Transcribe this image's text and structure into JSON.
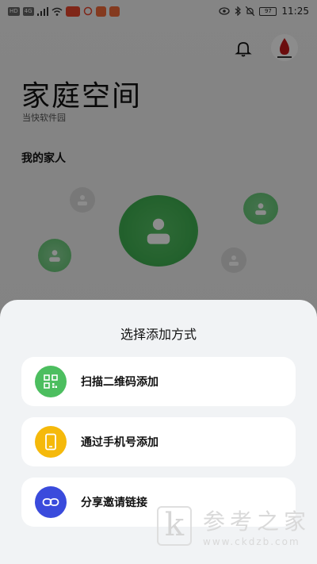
{
  "status_bar": {
    "left_badges": [
      "HD",
      "4G"
    ],
    "battery": "97",
    "time": "11:25"
  },
  "header": {
    "title": "家庭空间",
    "subtitle": "当快软件园"
  },
  "family": {
    "section_title": "我的家人"
  },
  "sheet": {
    "title": "选择添加方式",
    "options": [
      {
        "label": "扫描二维码添加",
        "icon": "qr-code-icon",
        "color": "#4cbe5f"
      },
      {
        "label": "通过手机号添加",
        "icon": "phone-icon",
        "color": "#f5b90b"
      },
      {
        "label": "分享邀请链接",
        "icon": "link-icon",
        "color": "#3a4bdc"
      }
    ]
  },
  "watermark": {
    "letter": "k",
    "text": "参考之家",
    "url": "www.ckdzb.com"
  },
  "colors": {
    "green": "#4cbe5f",
    "yellow": "#f5b90b",
    "blue": "#3a4bdc"
  }
}
